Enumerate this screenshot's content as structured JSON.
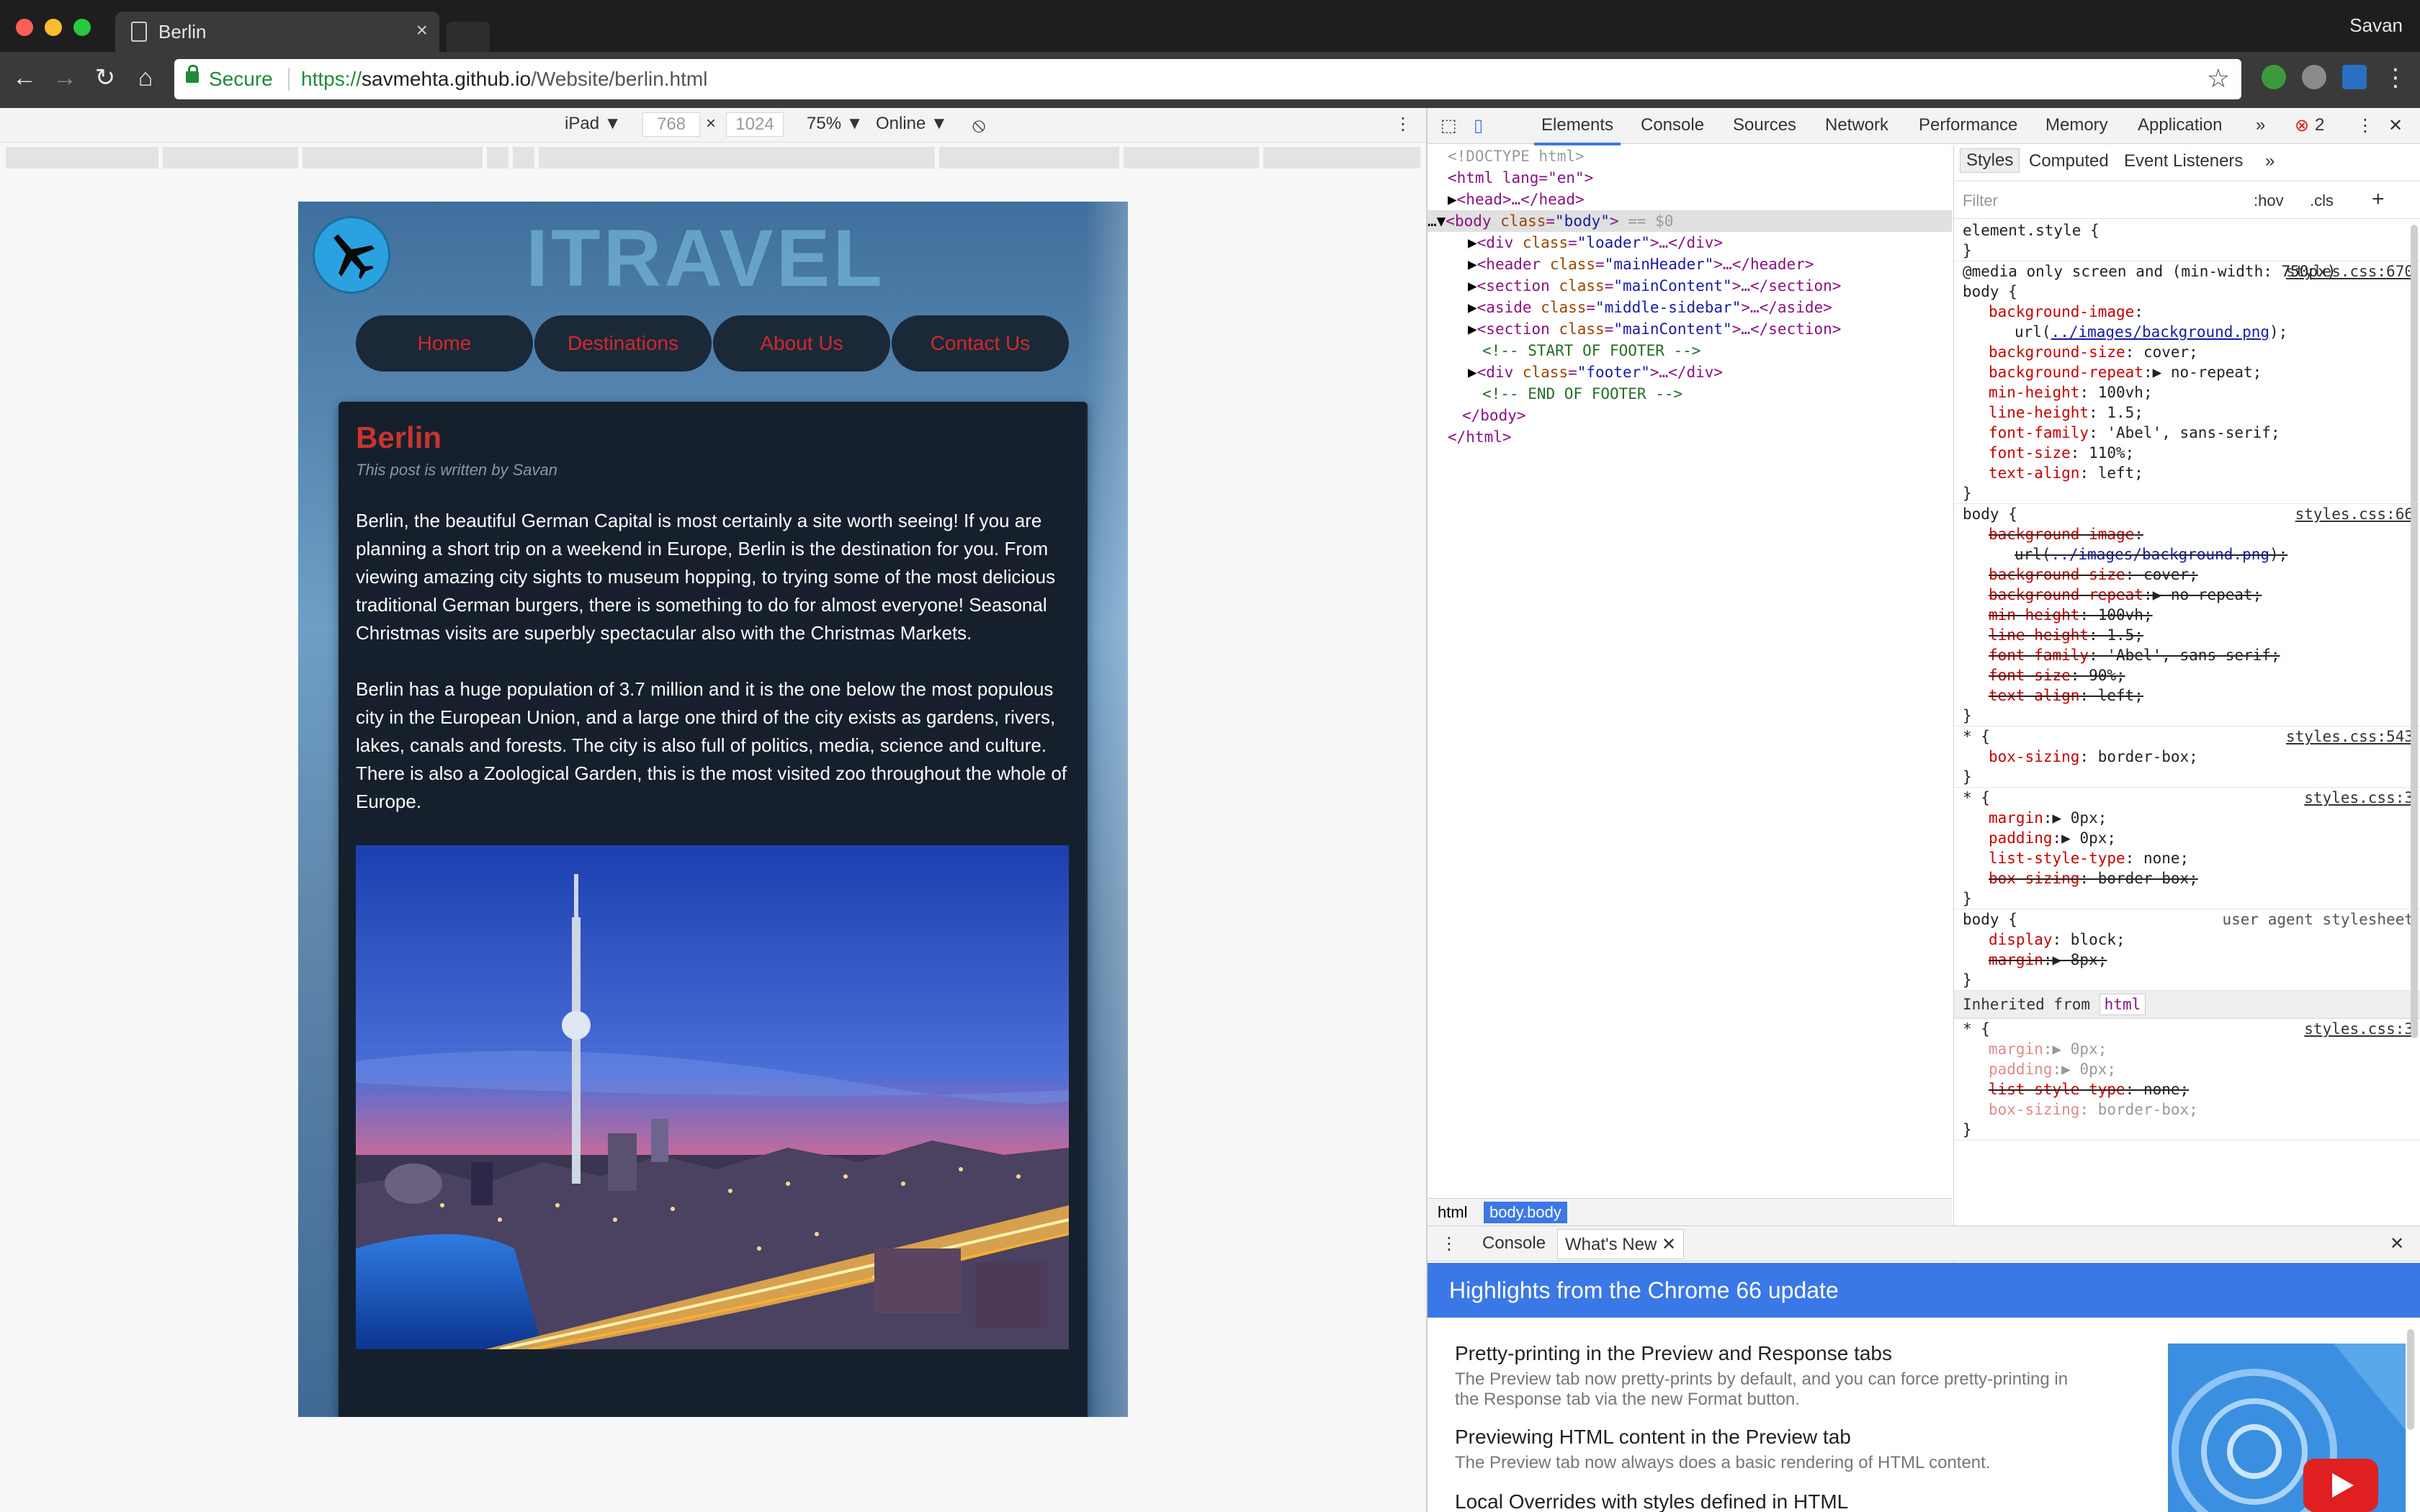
{
  "browser": {
    "tab_title": "Berlin",
    "tab_close": "×",
    "user_name": "Savan",
    "secure_label": "Secure",
    "url_scheme": "https://",
    "url_host": "savmehta.github.io",
    "url_path": "/Website/berlin.html"
  },
  "device_toolbar": {
    "device": "iPad ▼",
    "width": "768",
    "times": "×",
    "height": "1024",
    "zoom": "75% ▼",
    "network": "Online ▼"
  },
  "site": {
    "brand": "ITRAVEL",
    "nav": [
      "Home",
      "Destinations",
      "About Us",
      "Contact Us"
    ],
    "title": "Berlin",
    "byline": "This post is written by Savan",
    "para1": "Berlin, the beautiful German Capital is most certainly a site worth seeing! If you are planning a short trip on a weekend in Europe, Berlin is the destination for you. From viewing amazing city sights to museum hopping, to trying some of the most delicious traditional German burgers, there is something to do for almost everyone! Seasonal Christmas visits are superbly spectacular also with the Christmas Markets.",
    "para2": "Berlin has a huge population of 3.7 million and it is the one below the most populous city in the European Union, and a large one third of the city exists as gardens, rivers, lakes, canals and forests. The city is also full of politics, media, science and culture. There is also a Zoological Garden, this is the most visited zoo throughout the whole of Europe."
  },
  "devtools": {
    "tabs": [
      "Elements",
      "Console",
      "Sources",
      "Network",
      "Performance",
      "Memory",
      "Application"
    ],
    "more": "»",
    "error_count": "2",
    "styles_tabs": [
      "Styles",
      "Computed",
      "Event Listeners"
    ],
    "filter_placeholder": "Filter",
    "hov": ":hov",
    "cls": ".cls",
    "dom": {
      "doctype": "<!DOCTYPE html>",
      "html_open": "<html lang=\"en\">",
      "head": "<head>…</head>",
      "body_eq": "== $0",
      "children": [
        {
          "tag": "div",
          "cls": "loader",
          "close": "…</div>"
        },
        {
          "tag": "header",
          "cls": "mainHeader",
          "close": "…</header>"
        },
        {
          "tag": "section",
          "cls": "mainContent",
          "close": "…</section>"
        },
        {
          "tag": "aside",
          "cls": "middle-sidebar",
          "close": "…</aside>"
        },
        {
          "tag": "section",
          "cls": "mainContent",
          "close": "…</section>"
        }
      ],
      "comment1": "<!-- START OF FOOTER -->",
      "footer": {
        "tag": "div",
        "cls": "footer",
        "close": "…</div>"
      },
      "comment2": "<!-- END OF FOOTER -->",
      "body_close": "</body>",
      "html_close": "</html>"
    },
    "crumbs": [
      "html",
      "body.body"
    ],
    "drawer_tabs": [
      "Console",
      "What's New"
    ],
    "banner": "Highlights from the Chrome 66 update",
    "news": [
      {
        "h": "Pretty-printing in the Preview and Response tabs",
        "d": "The Preview tab now pretty-prints by default, and you can force pretty-printing in the Response tab via the new Format button."
      },
      {
        "h": "Previewing HTML content in the Preview tab",
        "d": "The Preview tab now always does a basic rendering of HTML content."
      },
      {
        "h": "Local Overrides with styles defined in HTML",
        "d": ""
      }
    ]
  },
  "styles_rules": {
    "element_style": "element.style {",
    "media": "@media only screen and (min-width: 750px)",
    "r1_src": "styles.css:670",
    "r2_src": "styles.css:66",
    "r3_src": "styles.css:543",
    "r4_src": "styles.css:3",
    "r5_src": "user agent stylesheet",
    "inherited_label": "Inherited from",
    "inherited_tag": "html",
    "r6_src": "styles.css:3"
  },
  "colors": {
    "accent": "#3b78e7",
    "nav_text": "#d12a2a",
    "article_bg": "#16202c",
    "title": "#c8352f"
  }
}
